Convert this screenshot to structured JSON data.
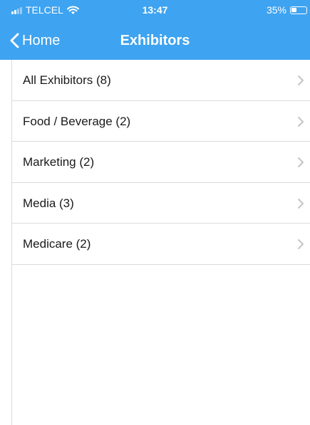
{
  "status_bar": {
    "carrier": "TELCEL",
    "time": "13:47",
    "battery_percent": "35%",
    "battery_level": 0.35,
    "signal_bars_active": 2,
    "signal_bars_total": 4
  },
  "navbar": {
    "back_label": "Home",
    "title": "Exhibitors",
    "background_color": "#3ea3f0"
  },
  "list": {
    "items": [
      {
        "label": "All Exhibitors (8)"
      },
      {
        "label": "Food / Beverage (2)"
      },
      {
        "label": "Marketing (2)"
      },
      {
        "label": "Media (3)"
      },
      {
        "label": "Medicare (2)"
      }
    ]
  },
  "icons": {
    "back": "chevron-left-icon",
    "disclosure": "chevron-right-icon",
    "wifi": "wifi-icon",
    "battery": "battery-icon",
    "signal": "signal-icon"
  }
}
